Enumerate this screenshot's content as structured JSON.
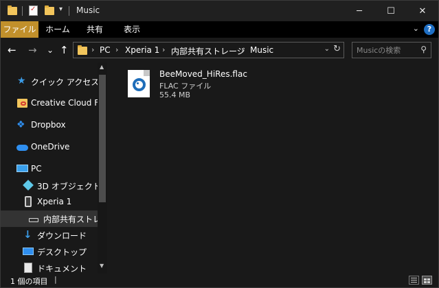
{
  "window": {
    "title": "Music",
    "controls": [
      "─",
      "☐",
      "✕"
    ]
  },
  "ribbon": {
    "tabs": [
      "ファイル",
      "ホーム",
      "共有",
      "表示"
    ],
    "help": "?"
  },
  "navigation": {
    "back": "←",
    "forward": "→",
    "recent": "⌄",
    "up": "↑"
  },
  "address": {
    "crumbs": [
      "PC",
      "Xperia 1",
      "内部共有ストレージ",
      "Music"
    ],
    "separator": "›"
  },
  "search": {
    "placeholder": "Musicの検索"
  },
  "nav_pane": {
    "items": [
      {
        "label": "クイック アクセス",
        "icon": "star-icon"
      },
      {
        "label": "Creative Cloud Files",
        "icon": "creative-cloud-folder-icon"
      },
      {
        "label": "Dropbox",
        "icon": "dropbox-icon"
      },
      {
        "label": "OneDrive",
        "icon": "cloud-icon"
      },
      {
        "label": "PC",
        "icon": "computer-icon"
      },
      {
        "label": "3D オブジェクト",
        "icon": "cube-icon"
      },
      {
        "label": "Xperia 1",
        "icon": "phone-icon"
      },
      {
        "label": "内部共有ストレージ",
        "icon": "drive-icon"
      },
      {
        "label": "ダウンロード",
        "icon": "download-icon"
      },
      {
        "label": "デスクトップ",
        "icon": "desktop-icon"
      },
      {
        "label": "ドキュメント",
        "icon": "document-icon"
      }
    ]
  },
  "files": [
    {
      "name": "BeeMoved_HiRes.flac",
      "type": "FLAC ファイル",
      "size": "55.4 MB",
      "icon": "audio-file-icon"
    }
  ],
  "status": {
    "item_count": "1 個の項目"
  },
  "colors": {
    "file_tab": "#c1902b",
    "background": "#191919",
    "accent_blue": "#1e6db9"
  }
}
